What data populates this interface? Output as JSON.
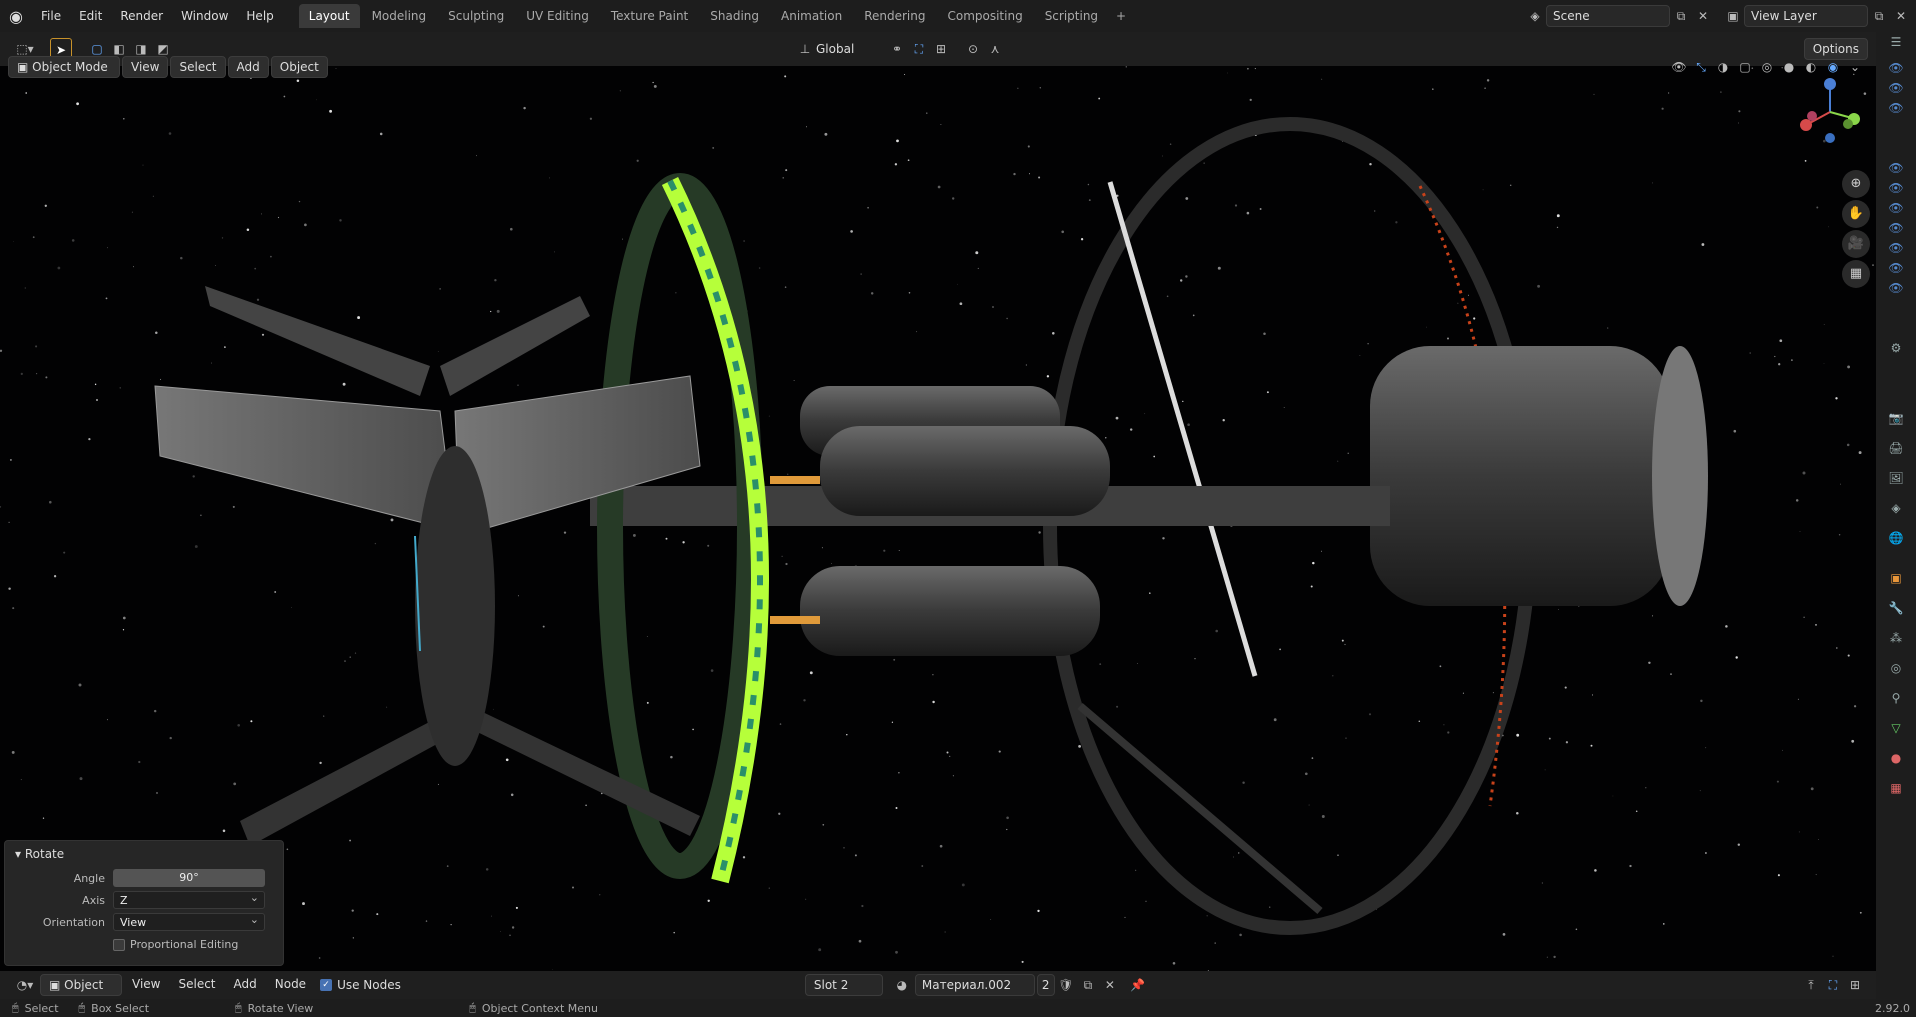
{
  "topbar": {
    "menus": [
      "File",
      "Edit",
      "Render",
      "Window",
      "Help"
    ],
    "tabs": [
      "Layout",
      "Modeling",
      "Sculpting",
      "UV Editing",
      "Texture Paint",
      "Shading",
      "Animation",
      "Rendering",
      "Compositing",
      "Scripting"
    ],
    "active_tab": "Layout",
    "scene_name": "Scene",
    "view_layer": "View Layer"
  },
  "header": {
    "mode": "Object Mode",
    "view": "View",
    "select": "Select",
    "add": "Add",
    "object": "Object",
    "orientation": "Global",
    "options": "Options"
  },
  "rotate_panel": {
    "title": "Rotate",
    "angle_label": "Angle",
    "angle_value": "90°",
    "axis_label": "Axis",
    "axis_value": "Z",
    "orientation_label": "Orientation",
    "orientation_value": "View",
    "proportional_label": "Proportional Editing"
  },
  "footer": {
    "editor": "Object",
    "view": "View",
    "select": "Select",
    "add": "Add",
    "node": "Node",
    "use_nodes": "Use Nodes",
    "slot": "Slot 2",
    "material": "Материал.002",
    "users": "2"
  },
  "status": {
    "select": "Select",
    "box_select": "Box Select",
    "rotate_view": "Rotate View",
    "context_menu": "Object Context Menu",
    "version": "2.92.0"
  },
  "gizmo": {
    "z": "Z"
  },
  "colors": {
    "accent": "#4772b3",
    "ring_glow": "#b6ff3a",
    "bg": "#1d1d1d"
  }
}
